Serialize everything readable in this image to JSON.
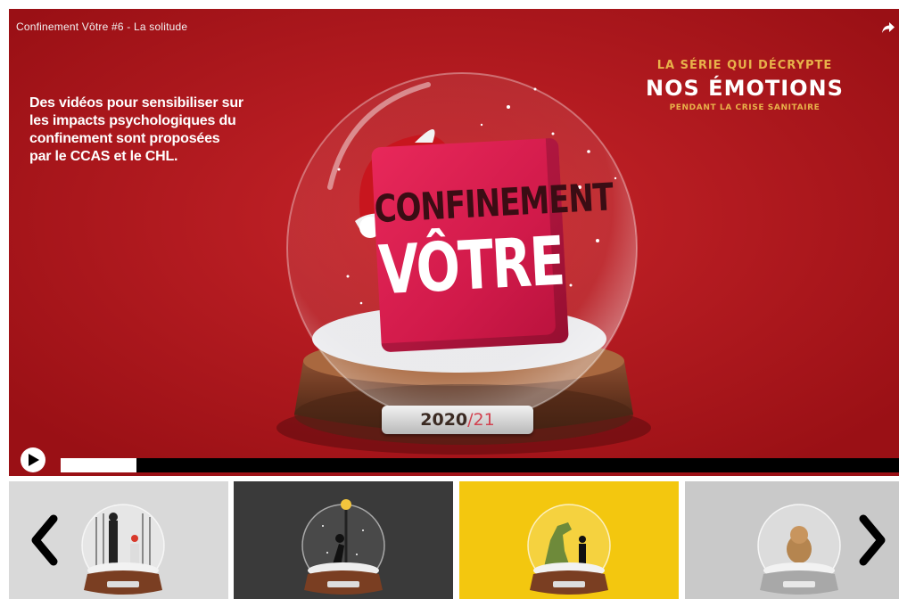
{
  "player": {
    "video_title": "Confinement Vôtre #6 - La solitude",
    "caption_lines": [
      "Des vidéos pour sensibiliser sur",
      "les impacts psychologiques du",
      "confinement sont proposées",
      "par le CCAS et le CHL."
    ],
    "series_line1": "LA SÉRIE QUI DÉCRYPTE",
    "series_line2": "NOS ÉMOTIONS",
    "series_line3": "PENDANT LA CRISE SANITAIRE",
    "cube_line1": "CONFINEMENT",
    "cube_line2": "VÔTRE",
    "year_main": "2020",
    "year_sep": "/",
    "year_end": "21",
    "progress_fraction": 0.09,
    "icons": {
      "play": "play-icon",
      "share": "share-icon"
    },
    "colors": {
      "background": "#b3161b",
      "cube": "#d11a4a",
      "accent": "#e8b24a"
    }
  },
  "thumbnails": [
    {
      "background": "#d9d9d9",
      "scene": "prison-bars-figure"
    },
    {
      "background": "#3a3a3a",
      "scene": "lamp-figure"
    },
    {
      "background": "#f3c70f",
      "scene": "dinosaur-figure"
    },
    {
      "background": "#c9c9c9",
      "scene": "puppy-figure"
    }
  ],
  "navigation": {
    "prev_icon": "chevron-left-icon",
    "next_icon": "chevron-right-icon"
  }
}
